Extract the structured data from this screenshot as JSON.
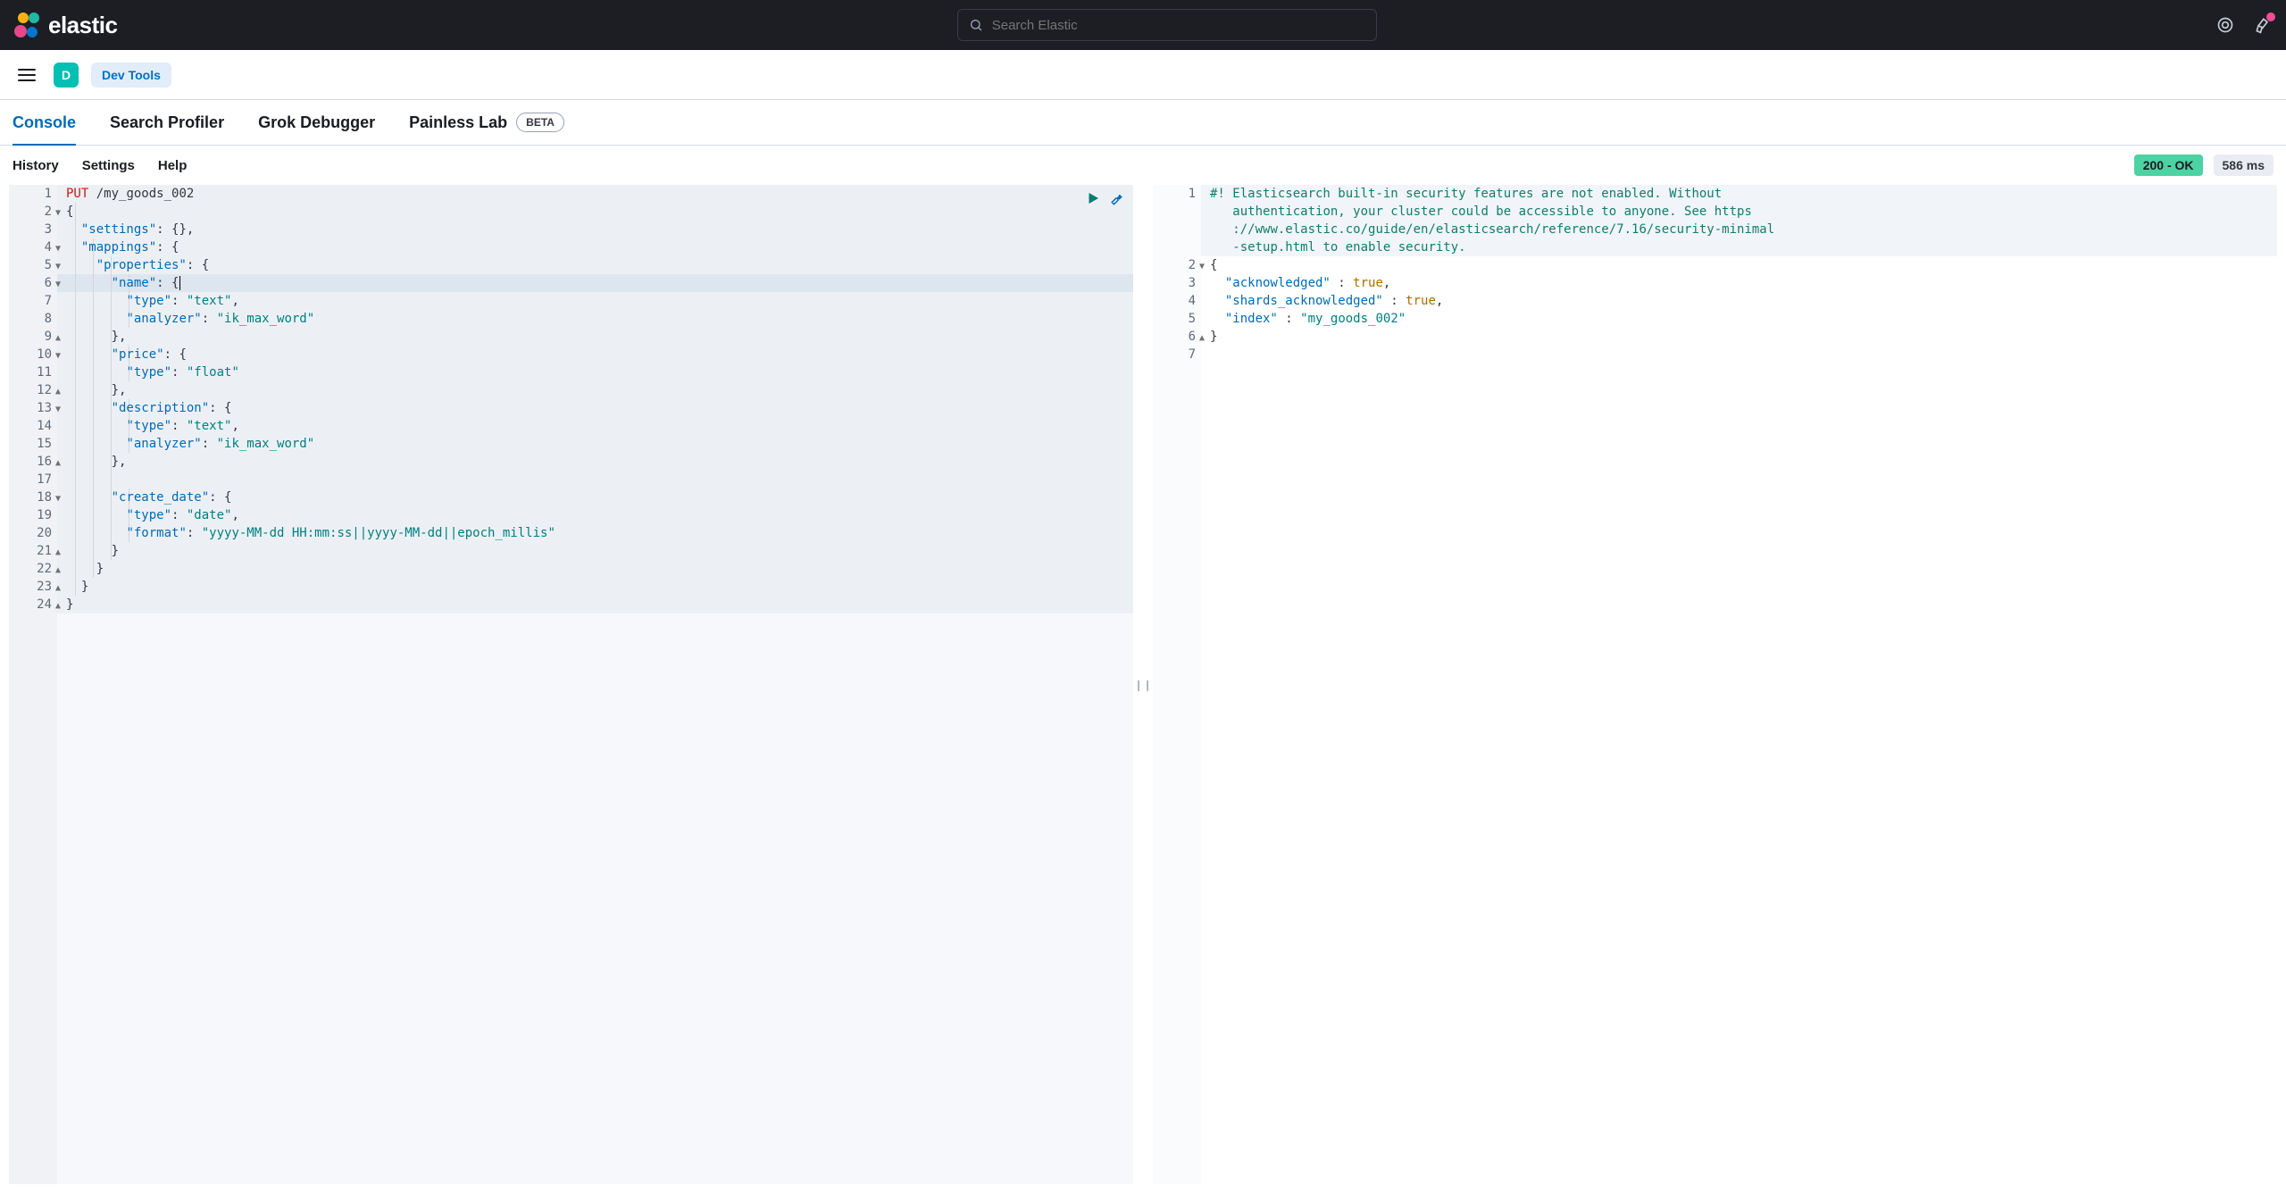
{
  "header": {
    "brand": "elastic",
    "search_placeholder": "Search Elastic"
  },
  "secondary": {
    "avatar_letter": "D",
    "breadcrumb": "Dev Tools"
  },
  "tabs": [
    {
      "label": "Console",
      "active": true
    },
    {
      "label": "Search Profiler"
    },
    {
      "label": "Grok Debugger"
    },
    {
      "label": "Painless Lab",
      "badge": "BETA"
    }
  ],
  "toolbar": {
    "history": "History",
    "settings": "Settings",
    "help": "Help",
    "status": "200 - OK",
    "latency": "586 ms"
  },
  "request": {
    "method": "PUT",
    "path": "/my_goods_002",
    "lines": [
      "1",
      "2",
      "3",
      "4",
      "5",
      "6",
      "7",
      "8",
      "9",
      "10",
      "11",
      "12",
      "13",
      "14",
      "15",
      "16",
      "17",
      "18",
      "19",
      "20",
      "21",
      "22",
      "23",
      "24"
    ],
    "fold": {
      "2": "open",
      "4": "open",
      "5": "open",
      "6": "open",
      "9": "close",
      "10": "open",
      "12": "close",
      "13": "open",
      "16": "close",
      "18": "open",
      "21": "close",
      "22": "close",
      "23": "close",
      "24": "close"
    },
    "body": {
      "settings": {},
      "mappings": {
        "properties": {
          "name": {
            "type": "text",
            "analyzer": "ik_max_word"
          },
          "price": {
            "type": "float"
          },
          "description": {
            "type": "text",
            "analyzer": "ik_max_word"
          },
          "create_date": {
            "type": "date",
            "format": "yyyy-MM-dd HH:mm:ss||yyyy-MM-dd||epoch_millis"
          }
        }
      }
    }
  },
  "response": {
    "lines": [
      "1",
      "2",
      "3",
      "4",
      "5",
      "6",
      "7"
    ],
    "fold": {
      "2": "open",
      "6": "close"
    },
    "warning": "#! Elasticsearch built-in security features are not enabled. Without authentication, your cluster could be accessible to anyone. See https://www.elastic.co/guide/en/elasticsearch/reference/7.16/security-minimal-setup.html to enable security.",
    "body": {
      "acknowledged": true,
      "shards_acknowledged": true,
      "index": "my_goods_002"
    }
  }
}
